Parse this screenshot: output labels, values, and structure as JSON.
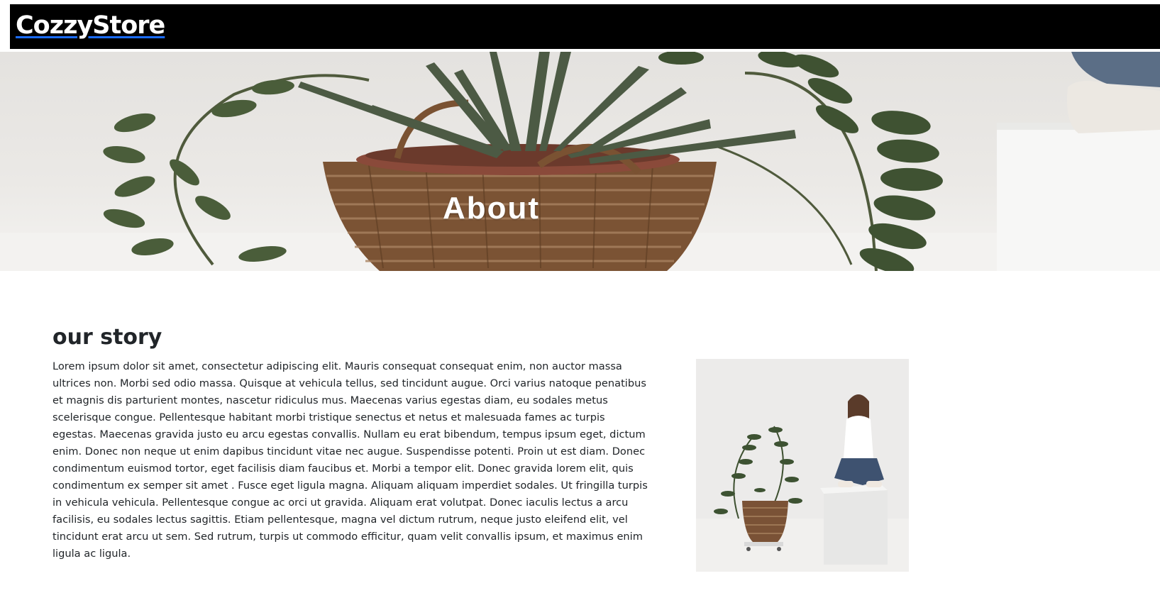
{
  "navbar": {
    "brand": "CozzyStore",
    "background": "#000000",
    "brand_underline_color": "#1a6cff"
  },
  "hero": {
    "title": "About",
    "image_description_icon": "potted-plant-in-basket-image"
  },
  "story": {
    "heading": "our story",
    "body": "Lorem ipsum dolor sit amet, consectetur adipiscing elit. Mauris consequat consequat enim, non auctor massa ultrices non. Morbi sed odio massa. Quisque at vehicula tellus, sed tincidunt augue. Orci varius natoque penatibus et magnis dis parturient montes, nascetur ridiculus mus. Maecenas varius egestas diam, eu sodales metus scelerisque congue. Pellentesque habitant morbi tristique senectus et netus et malesuada fames ac turpis egestas. Maecenas gravida justo eu arcu egestas convallis. Nullam eu erat bibendum, tempus ipsum eget, dictum enim. Donec non neque ut enim dapibus tincidunt vitae nec augue. Suspendisse potenti. Proin ut est diam. Donec condimentum euismod tortor, eget facilisis diam faucibus et. Morbi a tempor elit. Donec gravida lorem elit, quis condimentum ex semper sit amet . Fusce eget ligula magna. Aliquam aliquam imperdiet sodales. Ut fringilla turpis in vehicula vehicula. Pellentesque congue ac orci ut gravida. Aliquam erat volutpat. Donec iaculis lectus a arcu facilisis, eu sodales lectus sagittis. Etiam pellentesque, magna vel dictum rutrum, neque justo eleifend elit, vel tincidunt erat arcu ut sem. Sed rutrum, turpis ut commodo efficitur, quam velit convallis ipsum, et maximus enim ligula ac ligula.",
    "image_icon": "woman-sitting-with-plant-image"
  }
}
